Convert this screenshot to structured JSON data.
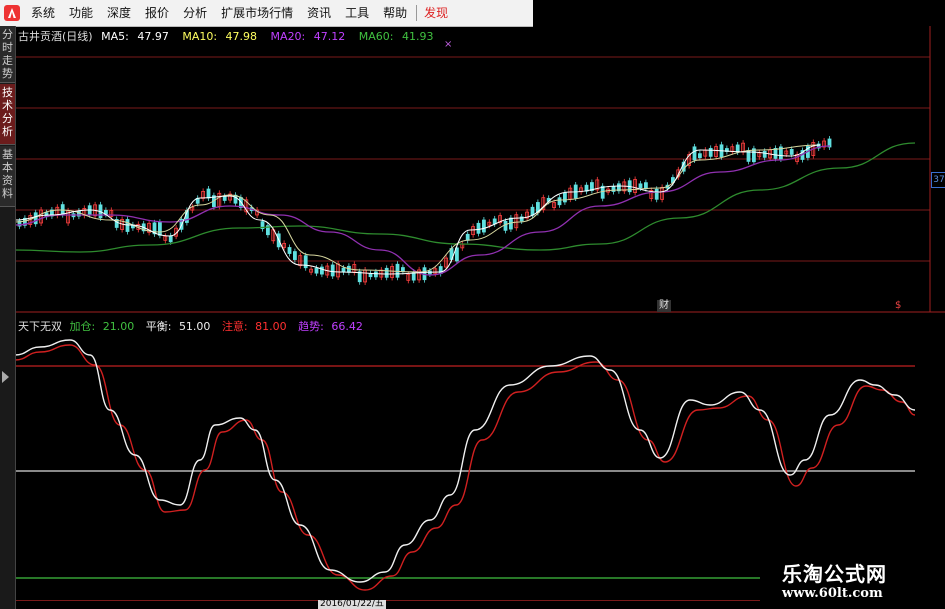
{
  "menu": {
    "items": [
      "系统",
      "功能",
      "深度",
      "报价",
      "分析",
      "扩展市场行情",
      "资讯",
      "工具",
      "帮助"
    ],
    "active_item": "发现"
  },
  "sidebar": {
    "tabs": [
      {
        "label": "分时走势",
        "active": false
      },
      {
        "label": "技术分析",
        "active": true
      },
      {
        "label": "基本资料",
        "active": false
      }
    ]
  },
  "main_chart": {
    "title": "古井贡酒(日线)",
    "ma5": {
      "label": "MA5:",
      "value": "47.97",
      "color": "#ffffff"
    },
    "ma10": {
      "label": "MA10:",
      "value": "47.98",
      "color": "#ffff00"
    },
    "ma20": {
      "label": "MA20:",
      "value": "47.12",
      "color": "#c040ff"
    },
    "ma60": {
      "label": "MA60:",
      "value": "41.93",
      "color": "#40c040"
    },
    "price_tag": "37",
    "event_marks": [
      "财",
      "$"
    ]
  },
  "indicator": {
    "name": "天下无双",
    "jiacang": {
      "label": "加仓:",
      "value": "21.00",
      "color": "#40c040"
    },
    "pingheng": {
      "label": "平衡:",
      "value": "51.00",
      "color": "#ffffff"
    },
    "zhuyi": {
      "label": "注意:",
      "value": "81.00",
      "color": "#ff3030"
    },
    "qushi": {
      "label": "趋势:",
      "value": "66.42",
      "color": "#c040ff"
    },
    "date_label": "2016/01/22/五"
  },
  "watermark": {
    "title": "乐淘公式网",
    "url": "www.60lt.com"
  },
  "colors": {
    "up": "#ff3030",
    "down": "#40e0e0",
    "grid": "#8b1a1a",
    "ma60": "#2e8b2e",
    "ma20": "#9030b0"
  }
}
